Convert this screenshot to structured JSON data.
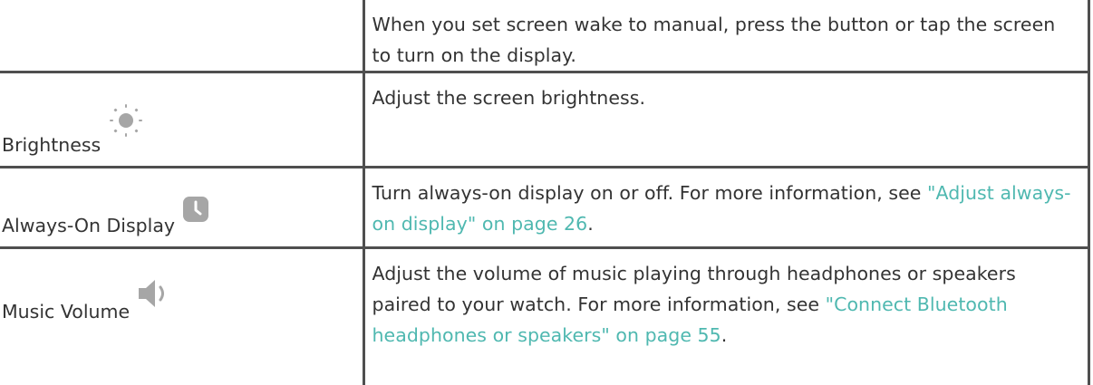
{
  "rows": [
    {
      "label": "",
      "icon": null,
      "description": "When you set screen wake to manual, press the button or tap the screen to turn on the display."
    },
    {
      "label": "Brightness",
      "icon": "sun-brightness-icon",
      "description": "Adjust the screen brightness."
    },
    {
      "label": "Always-On Display",
      "icon": "clock-icon",
      "description": "Turn always-on display on or off. For more information, see ",
      "link": "\"Adjust always-on display\" on page 26",
      "suffix": "."
    },
    {
      "label": "Music Volume",
      "icon": "speaker-volume-icon",
      "description": "Adjust the volume of music playing through headphones or speakers paired to your watch. For more information, see ",
      "link": "\"Connect Bluetooth headphones or speakers\" on page 55",
      "suffix": "."
    }
  ],
  "colors": {
    "text": "#333333",
    "link": "#4fb8b0",
    "border": "#4f4f4f",
    "icon_gray": "#a6a6a6"
  }
}
